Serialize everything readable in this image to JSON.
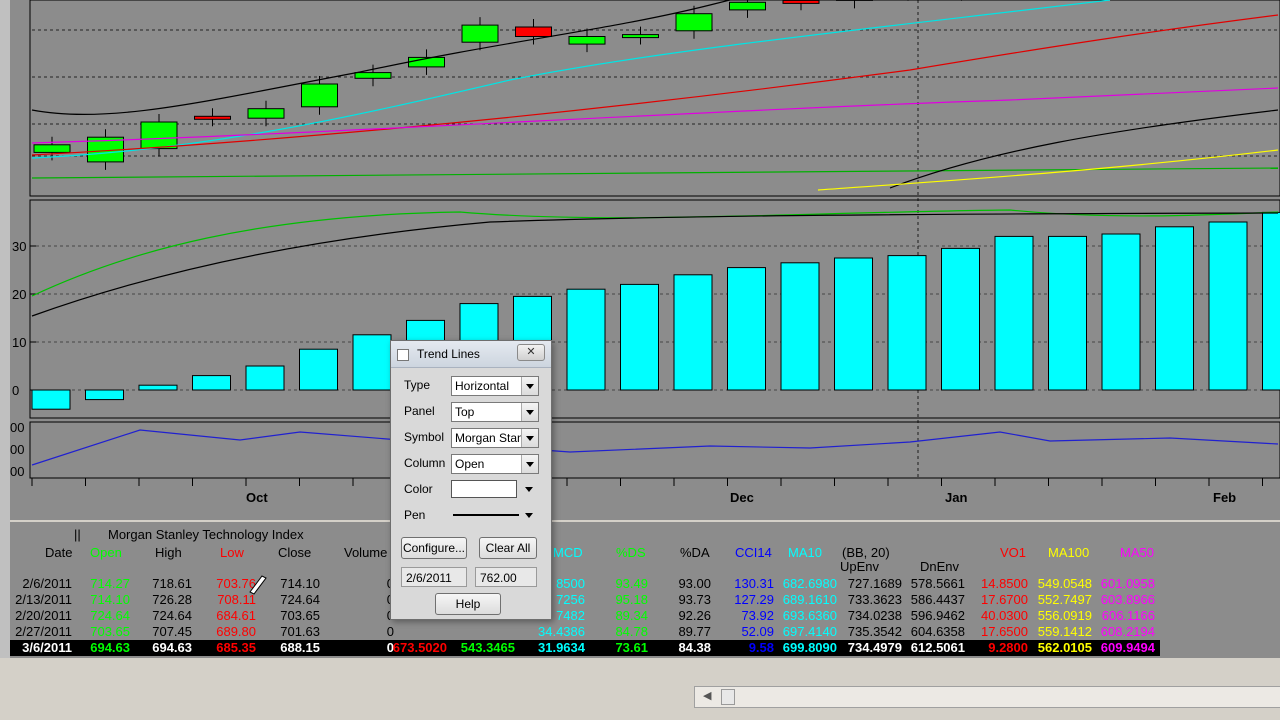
{
  "dialog": {
    "title": "Trend Lines",
    "close_label": "✕",
    "fields": [
      {
        "label": "Type",
        "value": "Horizontal"
      },
      {
        "label": "Panel",
        "value": "Top"
      },
      {
        "label": "Symbol",
        "value": "Morgan Stanley"
      },
      {
        "label": "Column",
        "value": "Open"
      }
    ],
    "color_label": "Color",
    "color_value": "#ffffff",
    "pen_label": "Pen",
    "configure_label": "Configure...",
    "clear_all_label": "Clear All",
    "date_value": "2/6/2011",
    "price_value": "762.00",
    "help_label": "Help"
  },
  "chart_data": {
    "type": "bar",
    "x_labels": [
      "Oct",
      "Dec",
      "Jan",
      "Feb"
    ],
    "y_ticks": [
      "30",
      "20",
      "10",
      "0"
    ],
    "bars": [
      -4,
      -2,
      1,
      3,
      5,
      8.5,
      11.5,
      14.5,
      18,
      19.5,
      21,
      22,
      24,
      25.5,
      26.5,
      27.5,
      28,
      29.5,
      32,
      32,
      32.5,
      34,
      35,
      37
    ],
    "top_candles": [
      {
        "open": 716,
        "close": 720,
        "color": "#00ff00"
      },
      {
        "open": 711,
        "close": 724,
        "color": "#00ff00"
      },
      {
        "open": 718,
        "close": 732,
        "color": "#00ff00"
      },
      {
        "open": 735,
        "close": 734,
        "color": "#ff0000"
      },
      {
        "open": 734,
        "close": 739,
        "color": "#00ff00"
      },
      {
        "open": 740,
        "close": 752,
        "color": "#00ff00"
      },
      {
        "open": 755,
        "close": 758,
        "color": "#00ff00"
      },
      {
        "open": 761,
        "close": 766,
        "color": "#00ff00"
      },
      {
        "open": 774,
        "close": 783,
        "color": "#00ff00"
      },
      {
        "open": 782,
        "close": 777,
        "color": "#ff0000"
      },
      {
        "open": 773,
        "close": 777,
        "color": "#00ff00"
      },
      {
        "open": 777,
        "close": 778,
        "color": "#00ff00"
      },
      {
        "open": 780,
        "close": 789,
        "color": "#00ff00"
      },
      {
        "open": 791,
        "close": 795,
        "color": "#00ff00"
      },
      {
        "open": 796,
        "close": 795,
        "color": "#ff0000"
      },
      {
        "open": 796,
        "close": 799,
        "color": "#00ff00"
      },
      {
        "open": 800,
        "close": 800,
        "color": "#000000"
      },
      {
        "open": 800,
        "close": 808,
        "color": "#00ff00"
      }
    ],
    "grid": true
  },
  "table": {
    "title": "Morgan Stanley Technology Index",
    "headers": [
      {
        "text": "Date",
        "color": "#000000"
      },
      {
        "text": "Open",
        "color": "#00ff00"
      },
      {
        "text": "High",
        "color": "#000000"
      },
      {
        "text": "Low",
        "color": "#ff0000"
      },
      {
        "text": "Close",
        "color": "#000000"
      },
      {
        "text": "Volume",
        "color": "#000000"
      },
      {
        "text": "MCD",
        "color": "#00ffff"
      },
      {
        "text": "%DS",
        "color": "#00ff00"
      },
      {
        "text": "%DA",
        "color": "#000000"
      },
      {
        "text": "CCI14",
        "color": "#0000ff"
      },
      {
        "text": "MA10",
        "color": "#00ffff"
      },
      {
        "text": "(BB, 20)",
        "color": "#000000"
      },
      {
        "text": "UpEnv",
        "color": "#000000"
      },
      {
        "text": "DnEnv",
        "color": "#000000"
      },
      {
        "text": "VO1",
        "color": "#ff0000"
      },
      {
        "text": "MA100",
        "color": "#ffff00"
      },
      {
        "text": "MA50",
        "color": "#ff00ff"
      }
    ],
    "rows": [
      {
        "date": "2/6/2011",
        "open": "714.27",
        "high": "718.61",
        "low": "703.76",
        "close": "714.10",
        "vol": "0",
        "mcd": "8500",
        "ds": "93.49",
        "da": "93.00",
        "cci": "130.31",
        "ma10": "682.6980",
        "bb": "727.1689",
        "dnenv": "578.5661",
        "vo1": "14.8500",
        "ma100": "549.0548",
        "ma50": "601.0958"
      },
      {
        "date": "2/13/2011",
        "open": "714.10",
        "high": "726.28",
        "low": "708.11",
        "close": "724.64",
        "vol": "0",
        "mcd": "7256",
        "ds": "95.18",
        "da": "93.73",
        "cci": "127.29",
        "ma10": "689.1610",
        "bb": "733.3623",
        "dnenv": "586.4437",
        "vo1": "17.6700",
        "ma100": "552.7497",
        "ma50": "603.8966"
      },
      {
        "date": "2/20/2011",
        "open": "724.64",
        "high": "724.64",
        "low": "684.61",
        "close": "703.65",
        "vol": "0",
        "mcd": "7482",
        "ds": "89.34",
        "da": "92.26",
        "cci": "73.92",
        "ma10": "693.6360",
        "bb": "734.0238",
        "dnenv": "596.9462",
        "vo1": "40.0300",
        "ma100": "556.0919",
        "ma50": "606.1166"
      },
      {
        "date": "2/27/2011",
        "open": "703.65",
        "high": "707.45",
        "low": "689.80",
        "close": "701.63",
        "vol": "0",
        "mcd": "34.4386",
        "ds": "84.78",
        "da": "89.77",
        "cci": "52.09",
        "ma10": "697.4140",
        "bb": "735.3542",
        "dnenv": "604.6358",
        "vo1": "17.6500",
        "ma100": "559.1412",
        "ma50": "608.2194"
      },
      {
        "date": "3/6/2011",
        "open": "694.63",
        "high": "694.63",
        "low": "685.35",
        "close": "688.15",
        "vol": "0",
        "mcd2": "673.5020",
        "mcd3": "543.3465",
        "mcd": "31.9634",
        "ds": "73.61",
        "da": "84.38",
        "cci": "9.58",
        "ma10": "699.8090",
        "bb": "734.4979",
        "dnenv": "612.5061",
        "vo1": "9.2800",
        "ma100": "562.0105",
        "ma50": "609.9494"
      }
    ]
  }
}
